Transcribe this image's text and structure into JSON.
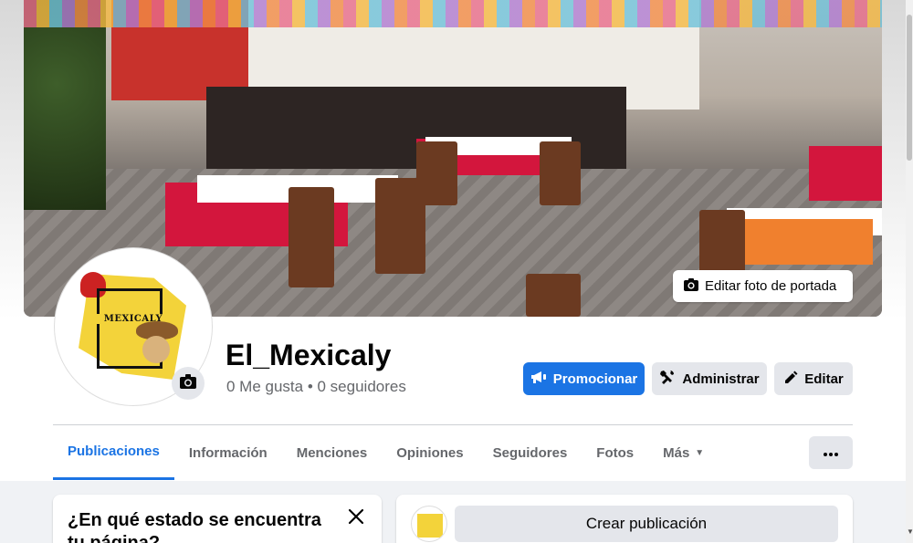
{
  "cover": {
    "edit_label": "Editar foto de portada",
    "edit_icon": "camera-icon"
  },
  "profile": {
    "name": "El_Mexicaly",
    "stats": "0 Me gusta • 0 seguidores",
    "avatar_text": "MEXICALY",
    "camera_icon": "camera-icon"
  },
  "actions": {
    "promote": {
      "label": "Promocionar",
      "icon": "megaphone-icon"
    },
    "admin": {
      "label": "Administrar",
      "icon": "tools-icon"
    },
    "edit": {
      "label": "Editar",
      "icon": "pencil-icon"
    }
  },
  "tabs": [
    {
      "label": "Publicaciones",
      "active": true
    },
    {
      "label": "Información",
      "active": false
    },
    {
      "label": "Menciones",
      "active": false
    },
    {
      "label": "Opiniones",
      "active": false
    },
    {
      "label": "Seguidores",
      "active": false
    },
    {
      "label": "Fotos",
      "active": false
    },
    {
      "label": "Más",
      "active": false
    }
  ],
  "more_menu_icon": "ellipsis-icon",
  "status_card": {
    "title": "¿En qué estado se encuentra tu página?",
    "close_icon": "close-icon"
  },
  "create_post": {
    "label": "Crear publicación"
  },
  "colors": {
    "accent": "#1b74e4",
    "secondary_button": "#e4e6eb",
    "background": "#f0f2f5"
  }
}
